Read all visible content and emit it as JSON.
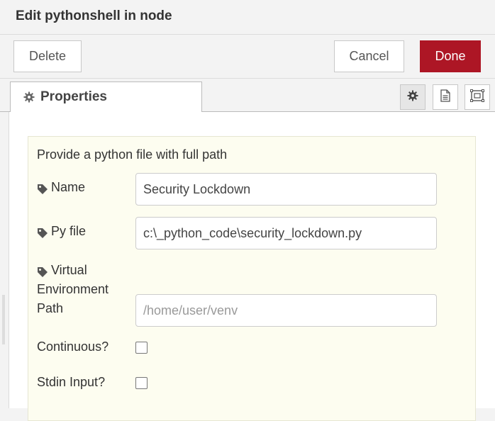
{
  "dialog": {
    "title": "Edit pythonshell in node"
  },
  "toolbar": {
    "delete_label": "Delete",
    "cancel_label": "Cancel",
    "done_label": "Done"
  },
  "tabs": {
    "properties_label": "Properties",
    "icons": [
      "gear-icon",
      "description-icon",
      "appearance-icon"
    ]
  },
  "form": {
    "hint": "Provide a python file with full path",
    "name": {
      "label": "Name",
      "value": "Security Lockdown"
    },
    "pyfile": {
      "label": "Py file",
      "value": "c:\\_python_code\\security_lockdown.py"
    },
    "venv": {
      "label_line1": "Virtual",
      "label_line2": "Environment",
      "label_line3": "Path",
      "value": "",
      "placeholder": "/home/user/venv"
    },
    "continuous": {
      "label": "Continuous?",
      "checked": false
    },
    "stdin": {
      "label": "Stdin Input?",
      "checked": false
    }
  },
  "colors": {
    "done_button": "#ad1625",
    "panel_background": "#fdfdf0"
  }
}
